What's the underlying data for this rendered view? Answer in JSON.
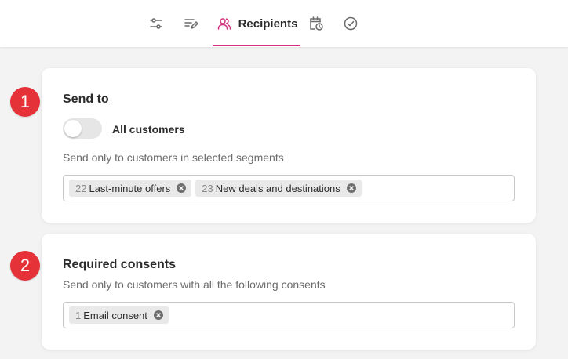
{
  "tabs": [
    {
      "icon": "sliders-icon"
    },
    {
      "icon": "list-edit-icon"
    },
    {
      "icon": "users-icon",
      "label": "Recipients",
      "active": true
    },
    {
      "icon": "calendar-clock-icon"
    },
    {
      "icon": "check-circle-icon"
    }
  ],
  "accent_color": "#d1317f",
  "badge_color": "#e53138",
  "send_to": {
    "step": "1",
    "title": "Send to",
    "toggle_label": "All customers",
    "toggle_on": false,
    "description": "Send only to customers in selected segments",
    "segments": [
      {
        "count": "22",
        "name": "Last-minute offers"
      },
      {
        "count": "23",
        "name": "New deals and destinations"
      }
    ]
  },
  "consents": {
    "step": "2",
    "title": "Required consents",
    "description": "Send only to customers with all the following consents",
    "items": [
      {
        "count": "1",
        "name": "Email consent"
      }
    ]
  }
}
